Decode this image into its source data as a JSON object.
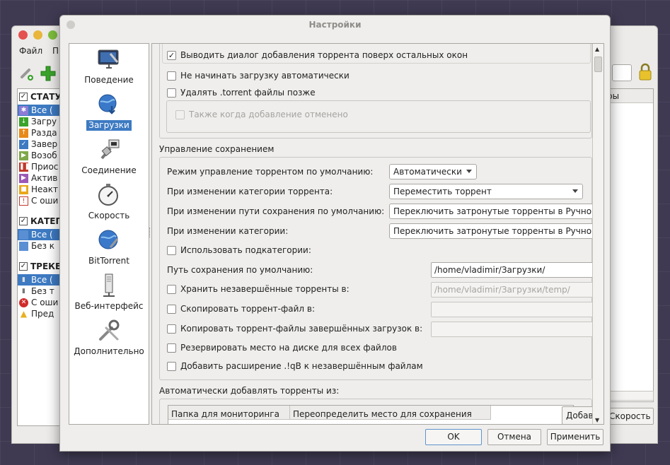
{
  "main_window": {
    "menu": [
      "Файл",
      "П"
    ],
    "filters": {
      "status_title": "СТАТУ",
      "status_items": [
        "Все (",
        "Загру",
        "Разда",
        "Завер",
        "Возоб",
        "Приос",
        "Актив",
        "Неакт",
        "С оши"
      ],
      "categories_title": "КАТЕГ",
      "category_items": [
        "Все (",
        "Без к"
      ],
      "trackers_title": "ТРЕКЕ",
      "tracker_items": [
        "Все (",
        "Без т",
        "С оши",
        "Пред"
      ]
    },
    "list_header": "ры",
    "speed_button": "Скорость"
  },
  "dialog": {
    "title": "Настройки",
    "categories": [
      {
        "label": "Поведение",
        "icon": "monitor-settings-icon"
      },
      {
        "label": "Загрузки",
        "icon": "globe-download-icon"
      },
      {
        "label": "Соединение",
        "icon": "network-plug-icon"
      },
      {
        "label": "Скорость",
        "icon": "stopwatch-icon"
      },
      {
        "label": "BitTorrent",
        "icon": "globe-tools-icon"
      },
      {
        "label": "Веб-интерфейс",
        "icon": "server-icon"
      },
      {
        "label": "Дополнительно",
        "icon": "wrench-tools-icon"
      }
    ],
    "torrent_adding": {
      "show_on_top": "Выводить диалог добавления торрента поверх остальных окон",
      "dont_start": "Не начинать загрузку автоматически",
      "delete_torrent_files": "Удалять .torrent файлы позже",
      "also_when_cancelled": "Также когда добавление отменено"
    },
    "saving": {
      "title": "Управление сохранением",
      "default_mode_label": "Режим управление торрентом по умолчанию:",
      "default_mode_value": "Автоматически",
      "category_change_label": "При изменении категории торрента:",
      "category_change_value": "Переместить торрент",
      "default_path_change_label": "При изменении пути сохранения по умолчанию:",
      "default_path_change_value": "Переключить затронутые торренты в Ручной",
      "category_path_change_label": "При изменении категории:",
      "category_path_change_value": "Переключить затронутые торренты в Ручной",
      "use_subcategories": "Использовать подкатегории:",
      "default_save_path_label": "Путь сохранения по умолчанию:",
      "default_save_path": "/home/vladimir/Загрузки/",
      "keep_incomplete_label": "Хранить незавершённые торренты в:",
      "keep_incomplete_path": "/home/vladimir/Загрузки/temp/",
      "copy_torrent_label": "Скопировать торрент-файл в:",
      "copy_finished_label": "Копировать торрент-файлы завершённых загрузок в:",
      "preallocate": "Резервировать место на диске для всех файлов",
      "append_qb": "Добавить расширение .!qB к незавершённым файлам"
    },
    "auto_add": {
      "title": "Автоматически добавлять торренты из:",
      "col_folder": "Папка для мониторинга",
      "col_override": "Переопределить место для сохранения",
      "add_button": "Добав"
    },
    "buttons": {
      "ok": "OK",
      "cancel": "Отмена",
      "apply": "Применить"
    }
  },
  "colors": {
    "selection": "#3d7ac2",
    "accent_green": "#3aa32b"
  }
}
